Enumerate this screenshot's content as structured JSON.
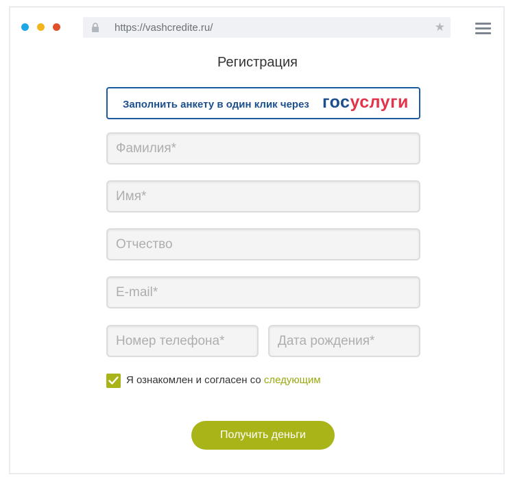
{
  "browser": {
    "url": "https://vashcredite.ru/",
    "icons": {
      "lock": "lock-icon",
      "bookmark": "star-icon",
      "menu": "hamburger-menu-icon"
    }
  },
  "form": {
    "title": "Регистрация",
    "gosuslugi": {
      "label": "Заполнить анкету в один клик через",
      "logo_part1": "гос",
      "logo_part2": "услуги"
    },
    "fields": {
      "last_name": {
        "placeholder": "Фамилия*",
        "value": ""
      },
      "first_name": {
        "placeholder": "Имя*",
        "value": ""
      },
      "patronymic": {
        "placeholder": "Отчество",
        "value": ""
      },
      "email": {
        "placeholder": "E-mail*",
        "value": ""
      },
      "phone": {
        "placeholder": "Номер телефона*",
        "value": ""
      },
      "birth_date": {
        "placeholder": "Дата рождения*",
        "value": ""
      }
    },
    "agreement": {
      "checked": true,
      "text": "Я ознакомлен и согласен со",
      "link": "следующим"
    },
    "submit_label": "Получить деньги"
  },
  "colors": {
    "accent": "#a9b418",
    "gosuslugi_blue": "#1c4f8c",
    "gosuslugi_red": "#e2334a",
    "dot_blue": "#1ea7e6",
    "dot_yellow": "#f2b51c",
    "dot_red": "#e0502a"
  }
}
